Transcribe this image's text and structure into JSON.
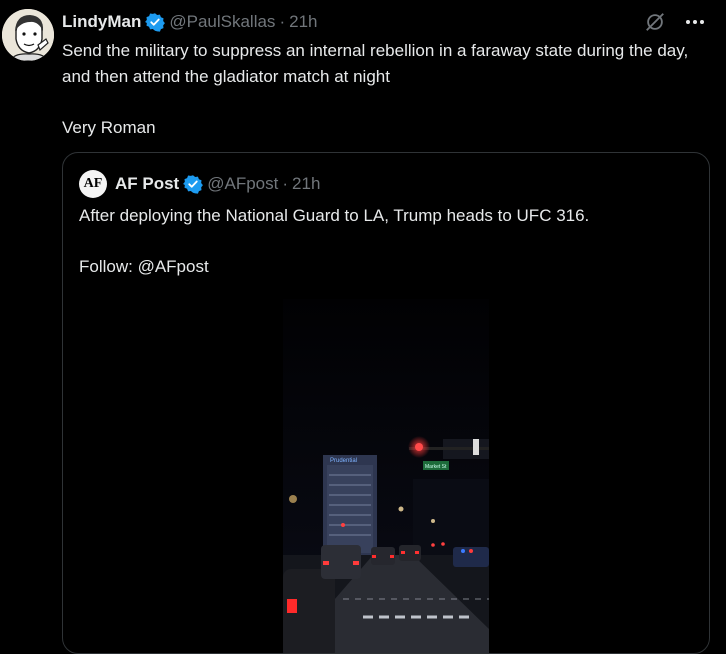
{
  "tweet": {
    "author_name": "LindyMan",
    "author_handle": "@PaulSkallas",
    "separator": "·",
    "time": "21h",
    "text_line1": "Send the military to suppress an internal rebellion in a faraway state during the day, and then attend the gladiator match at night",
    "text_line2": "Very Roman"
  },
  "quoted": {
    "avatar_text": "AF",
    "author_name": "AF Post",
    "author_handle": "@AFpost",
    "separator": "·",
    "time": "21h",
    "text_line1": "After deploying the National Guard to LA, Trump heads to UFC 316.",
    "text_line2": "Follow: @AFpost"
  },
  "video": {
    "sign_building": "Prudential",
    "sign_street": "Market St"
  },
  "icons": {
    "grok": "grok-icon",
    "more": "more-icon",
    "verified": "verified-badge-icon"
  },
  "colors": {
    "background": "#000000",
    "text": "#e7e9ea",
    "secondary": "#71767b",
    "verified_blue": "#1d9bf0",
    "border": "#2f3336"
  }
}
